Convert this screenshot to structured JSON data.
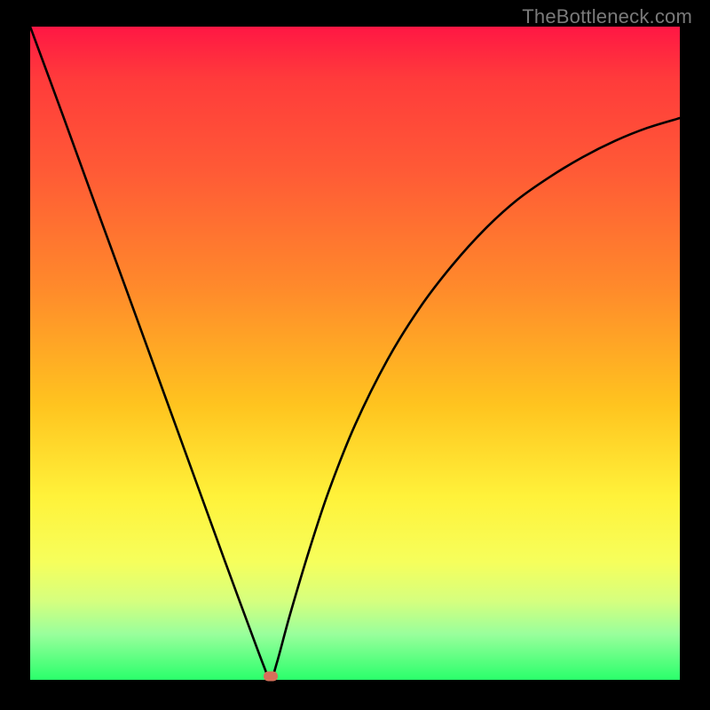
{
  "watermark": "TheBottleneck.com",
  "chart_data": {
    "type": "line",
    "title": "",
    "xlabel": "",
    "ylabel": "",
    "xlim": [
      0,
      100
    ],
    "ylim": [
      0,
      100
    ],
    "series": [
      {
        "name": "curve",
        "x": [
          0,
          5,
          10,
          15,
          20,
          25,
          30,
          33,
          36,
          37,
          38,
          40,
          43,
          46,
          50,
          55,
          60,
          65,
          70,
          75,
          80,
          85,
          90,
          95,
          100
        ],
        "y": [
          100,
          86.5,
          72.8,
          59.2,
          45.5,
          31.8,
          18.1,
          10,
          2,
          0,
          2.7,
          10,
          20,
          29,
          39,
          49,
          57,
          63.5,
          69,
          73.5,
          77,
          80,
          82.5,
          84.5,
          86
        ]
      }
    ],
    "marker": {
      "x": 37,
      "y": 0
    },
    "background_gradient": {
      "top": "#ff1744",
      "bottom": "#2aff6b"
    }
  }
}
